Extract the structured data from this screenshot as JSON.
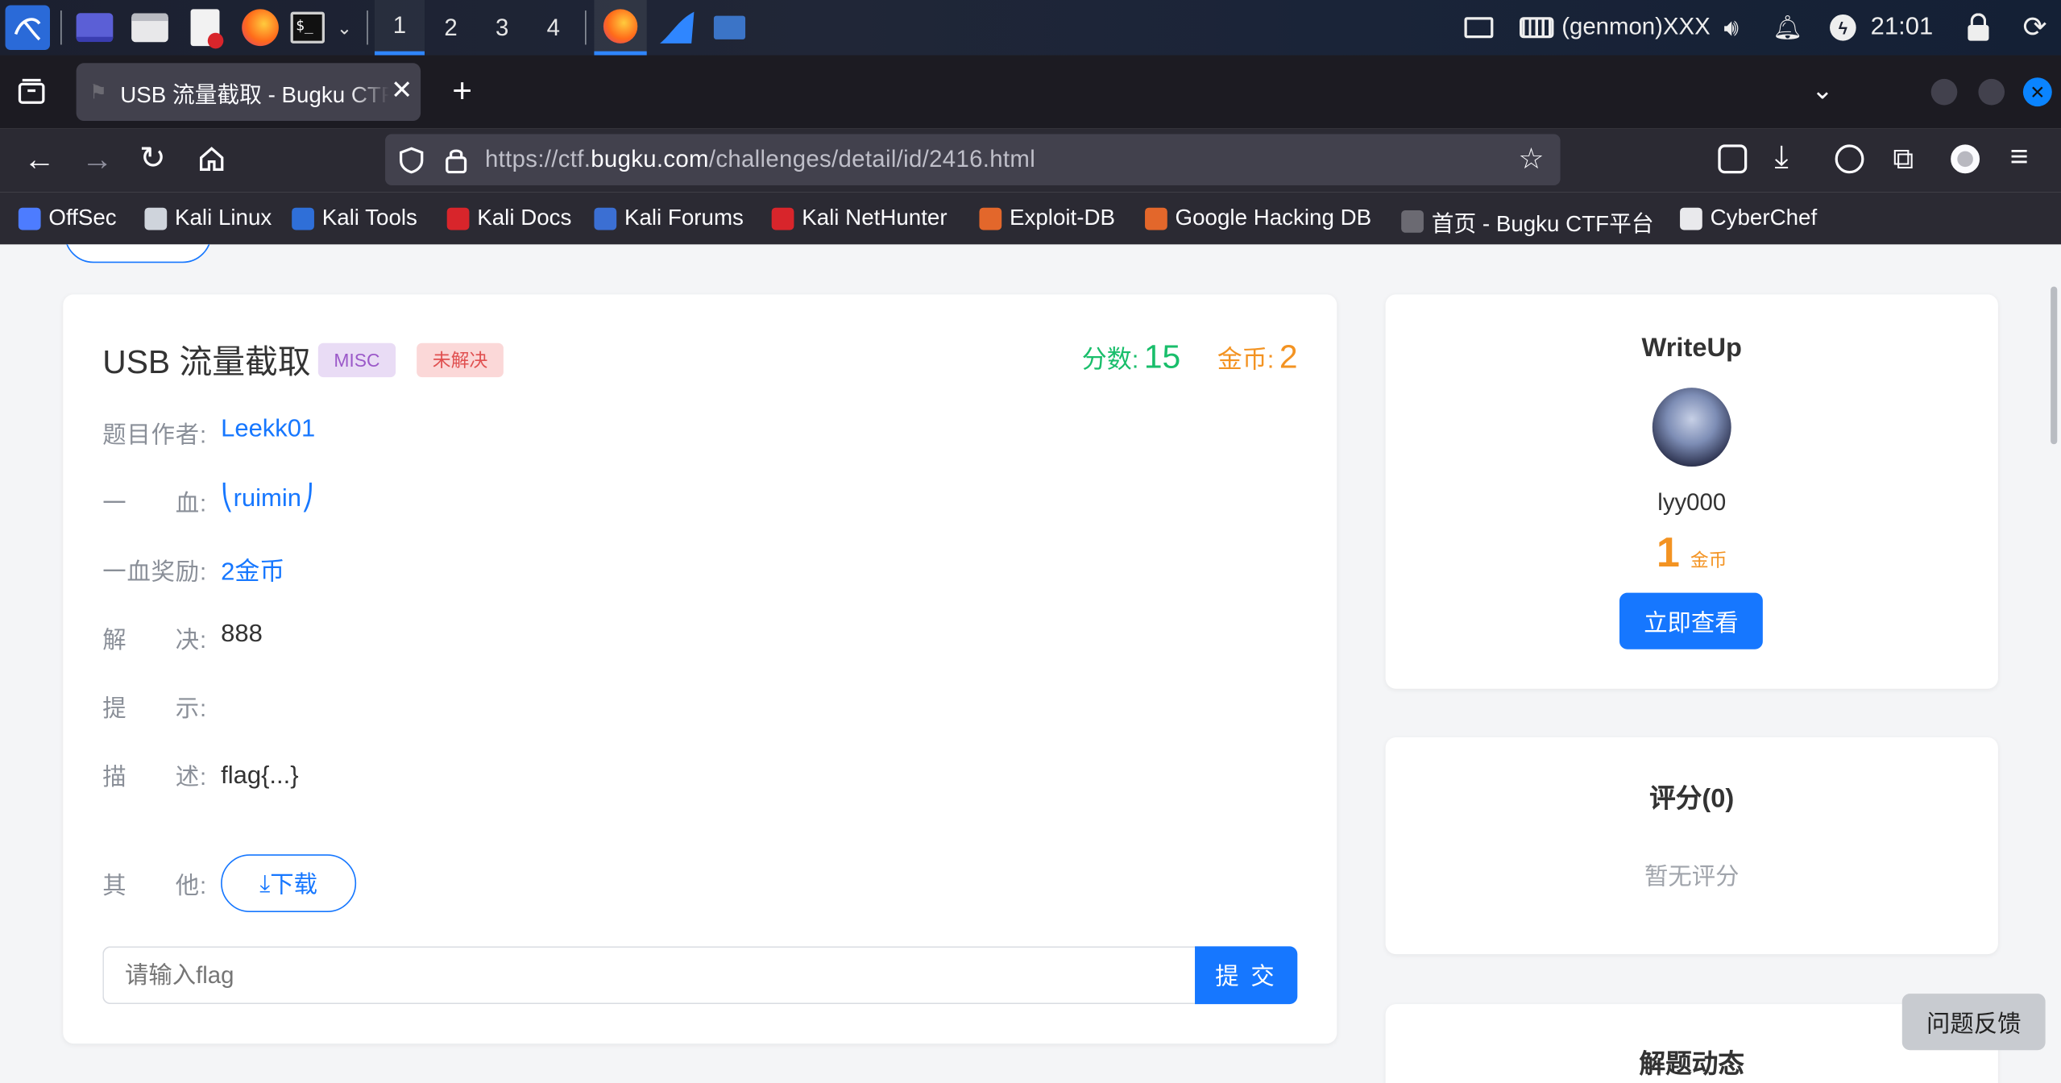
{
  "taskbar": {
    "workspaces": [
      "1",
      "2",
      "3",
      "4"
    ],
    "genmon": "(genmon)XXX",
    "clock": "21:01"
  },
  "browser": {
    "tab_title": "USB 流量截取 - Bugku CTF",
    "url_prefix": "https://ctf.",
    "url_domain": "bugku.com",
    "url_path": "/challenges/detail/id/2416.html",
    "bookmarks": [
      {
        "label": "OffSec",
        "icon_color": "#4d7cff"
      },
      {
        "label": "Kali Linux",
        "icon_color": "#cfd4dc"
      },
      {
        "label": "Kali Tools",
        "icon_color": "#2f6fd8"
      },
      {
        "label": "Kali Docs",
        "icon_color": "#d8252b"
      },
      {
        "label": "Kali Forums",
        "icon_color": "#3b6fd3"
      },
      {
        "label": "Kali NetHunter",
        "icon_color": "#d8252b"
      },
      {
        "label": "Exploit-DB",
        "icon_color": "#e3672b"
      },
      {
        "label": "Google Hacking DB",
        "icon_color": "#e3672b"
      },
      {
        "label": "首页 - Bugku CTF平台",
        "icon_color": "#6b6a72"
      },
      {
        "label": "CyberChef",
        "icon_color": "#e9e9ec"
      }
    ]
  },
  "challenge": {
    "title": "USB 流量截取",
    "category_badge": "MISC",
    "status_badge": "未解决",
    "score_label": "分数:",
    "score_value": "15",
    "coin_label": "金币:",
    "coin_value": "2",
    "fields": [
      {
        "label": "题目作者:",
        "value": "Leekk01",
        "is_link": true
      },
      {
        "label": "一　　血:",
        "value": "⎝ruimin⎠",
        "is_link": true
      },
      {
        "label": "一血奖励:",
        "value": "2金币",
        "is_link": true
      },
      {
        "label": "解　　决:",
        "value": "888",
        "is_link": false
      },
      {
        "label": "提　　示:",
        "value": "",
        "is_link": false
      },
      {
        "label": "描　　述:",
        "value": "flag{...}",
        "is_link": false
      }
    ],
    "other_label": "其　　他:",
    "download_label": "下载",
    "flag_placeholder": "请输入flag",
    "submit_label": "提 交"
  },
  "writeup": {
    "title": "WriteUp",
    "username": "lyy000",
    "coin_amount": "1",
    "coin_unit": "金币",
    "view_button": "立即查看"
  },
  "rating": {
    "title": "评分(0)",
    "empty_text": "暂无评分"
  },
  "solves": {
    "title": "解题动态"
  },
  "feedback_button": "问题反馈",
  "colors": {
    "accent": "#1677ff",
    "score_green": "#19be6b",
    "coin_orange": "#f39322",
    "misc_badge_bg": "#e9dcf5",
    "misc_badge_text": "#9b59c9",
    "status_badge_bg": "#fbd8d8",
    "status_badge_text": "#e05050"
  }
}
